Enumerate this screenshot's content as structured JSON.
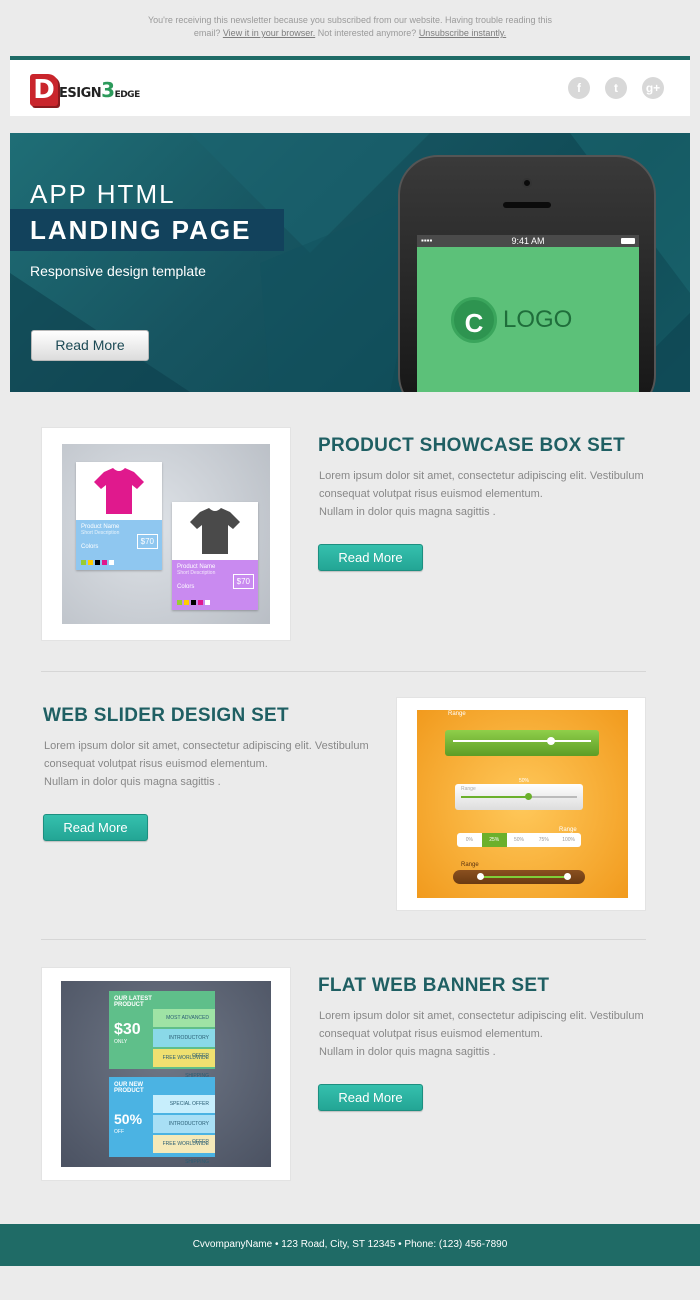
{
  "preheader": {
    "line1": "You're receiving this newsletter because you subscribed from our website. Having trouble reading this",
    "line2_prefix": "email?",
    "view_link": "View it in your browser.",
    "middle": "Not interested anymore?",
    "unsubscribe_link": "Unsubscribe instantly."
  },
  "header": {
    "logo": {
      "d": "D",
      "esign": "ESIGN",
      "three": "3",
      "edge": "EDGE"
    },
    "social": {
      "facebook": "f",
      "twitter": "t",
      "gplus": "g+"
    }
  },
  "hero": {
    "line1": "APP HTML",
    "line2": "LANDING PAGE",
    "subtitle": "Responsive design template",
    "button": "Read More",
    "phone": {
      "time": "9:41 AM",
      "logo_letter": "C",
      "logo_text": "LOGO"
    }
  },
  "products": [
    {
      "title": "PRODUCT SHOWCASE BOX SET",
      "text1": "Lorem ipsum dolor sit amet, consectetur adipiscing elit. Vestibulum",
      "text2": "consequat volutpat risus euismod elementum.",
      "text3": "Nullam in dolor quis magna sagittis .",
      "button": "Read More",
      "art": {
        "card1": {
          "name": "Product Name",
          "sub": "Short Description",
          "price": "$70",
          "colors": "Colors"
        },
        "card2": {
          "name": "Product Name",
          "sub": "Short Description",
          "price": "$70",
          "colors": "Colors"
        }
      }
    },
    {
      "title": "WEB SLIDER DESIGN SET",
      "text1": "Lorem ipsum dolor sit amet, consectetur adipiscing elit. Vestibulum",
      "text2": "consequat volutpat risus euismod elementum.",
      "text3": "Nullam in dolor quis magna sagittis .",
      "button": "Read More",
      "art": {
        "label1": "Range",
        "label2": "Range",
        "label3": "Range",
        "label4": "Range",
        "pct": "50%",
        "steps": [
          "0%",
          "25%",
          "50%",
          "75%",
          "100%"
        ]
      }
    },
    {
      "title": "FLAT WEB BANNER SET",
      "text1": "Lorem ipsum dolor sit amet, consectetur adipiscing elit. Vestibulum",
      "text2": "consequat volutpat risus euismod elementum.",
      "text3": "Nullam in dolor quis magna sagittis .",
      "button": "Read More",
      "art": {
        "b1_head": "OUR LATEST PRODUCT",
        "b1_price": "$30",
        "b1_only": "ONLY",
        "b1_s1": "MOST ADVANCED",
        "b1_s2": "INTRODUCTORY OFFER",
        "b1_s3": "FREE WORLDWIDE SHIPPING",
        "b2_head": "OUR NEW PRODUCT",
        "b2_price": "50%",
        "b2_off": "OFF",
        "b2_s1": "SPECIAL OFFER",
        "b2_s2": "INTRODUCTORY OFFER",
        "b2_s3": "FREE WORLDWIDE SHIPPING"
      }
    }
  ],
  "footer": {
    "text": "CvvompanyName • 123 Road, City, ST 12345 • Phone: (123) 456-7890"
  },
  "colors": {
    "teal_dark": "#1f6b66",
    "button_teal": "#2ab3a1",
    "title_teal": "#1f5f63",
    "hero_bg": "#175561"
  }
}
